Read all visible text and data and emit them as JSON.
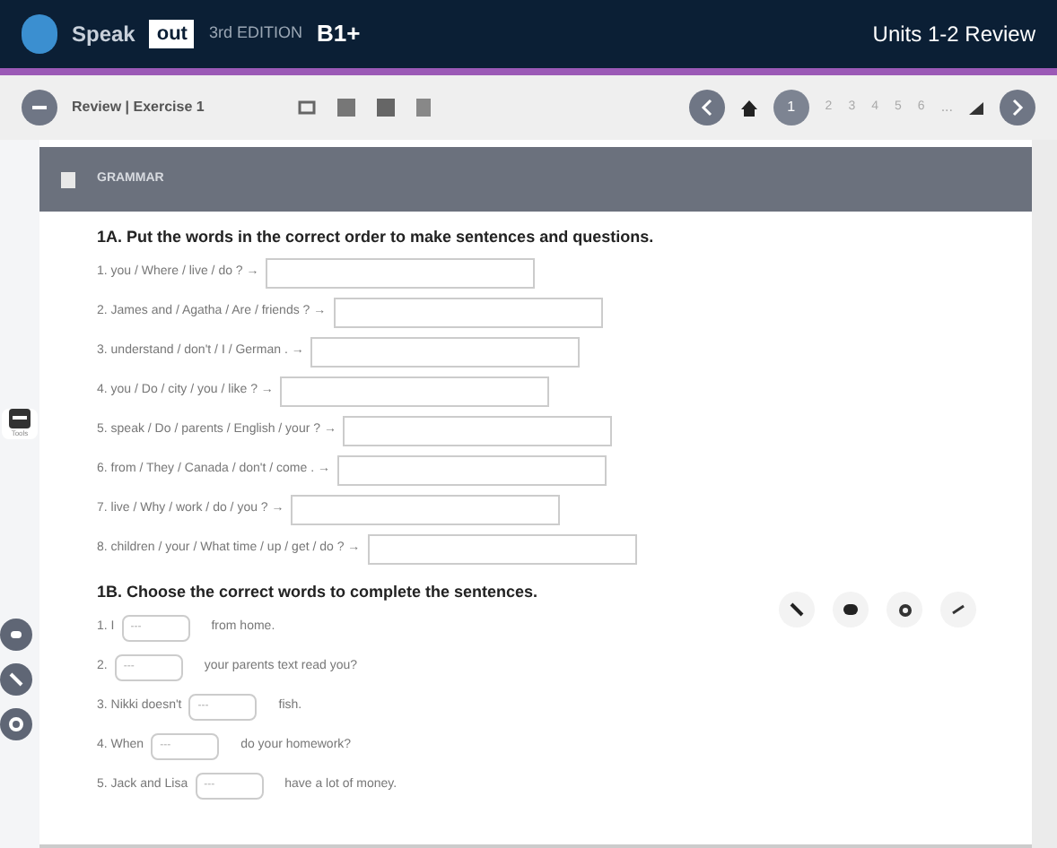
{
  "header": {
    "brand": "Speak",
    "brand_box": "out",
    "edition": "3rd EDITION",
    "level": "B1+",
    "title": "Units 1-2 Review"
  },
  "toolbar": {
    "breadcrumb": "Review | Exercise 1",
    "pages": [
      {
        "label": "1",
        "selected": true
      },
      {
        "label": "2",
        "selected": false
      },
      {
        "label": "3",
        "selected": false
      },
      {
        "label": "4",
        "selected": false
      },
      {
        "label": "5",
        "selected": false
      },
      {
        "label": "6",
        "selected": false
      }
    ],
    "ellipsis": "..."
  },
  "panel": {
    "heading": "GRAMMAR"
  },
  "side_tab": {
    "label": "Tools"
  },
  "section_a": {
    "instruction": "1A. Put the words in the correct order to make sentences and questions.",
    "items": [
      {
        "prompt": "1. you / Where / live / do ? →"
      },
      {
        "prompt": "2. James and / Agatha / Are / friends ? →"
      },
      {
        "prompt": "3. understand / don't / I / German . →"
      },
      {
        "prompt": "4. you / Do / city / you / like ? →"
      },
      {
        "prompt": "5. speak / Do / parents / English / your ? →"
      },
      {
        "prompt": "6. from / They / Canada / don't / come . →"
      },
      {
        "prompt": "7. live / Why / work / do / you ? →"
      },
      {
        "prompt": "8. children / your / What time / up / get / do ? →"
      }
    ]
  },
  "section_b": {
    "instruction": "1B. Choose the correct words to complete the sentences.",
    "items": [
      {
        "before": "1. I",
        "placeholder": "---",
        "after": "from home."
      },
      {
        "before": "2.",
        "placeholder": "---",
        "after": "your parents text read you?"
      },
      {
        "before": "3. Nikki doesn't",
        "placeholder": "---",
        "after": "fish."
      },
      {
        "before": "4. When",
        "placeholder": "---",
        "after": "do your homework?"
      },
      {
        "before": "5. Jack and Lisa",
        "placeholder": "---",
        "after": "have a lot of money."
      }
    ]
  }
}
